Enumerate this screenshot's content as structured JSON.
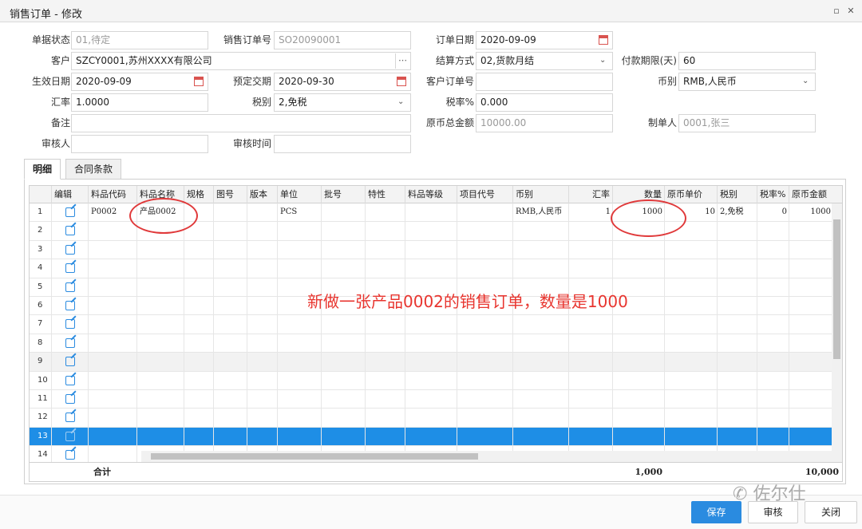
{
  "window": {
    "title": "销售订单 - 修改"
  },
  "form": {
    "status_label": "单据状态",
    "status_value": "01,待定",
    "order_no_label": "销售订单号",
    "order_no_value": "SO20090001",
    "order_date_label": "订单日期",
    "order_date_value": "2020-09-09",
    "customer_label": "客户",
    "customer_value": "SZCY0001,苏州XXXX有限公司",
    "settle_label": "结算方式",
    "settle_value": "02,货款月结",
    "pay_term_label": "付款期限(天)",
    "pay_term_value": "60",
    "effective_date_label": "生效日期",
    "effective_date_value": "2020-09-09",
    "delivery_date_label": "预定交期",
    "delivery_date_value": "2020-09-30",
    "cust_order_label": "客户订单号",
    "cust_order_value": "",
    "currency_label": "币别",
    "currency_value": "RMB,人民币",
    "rate_label": "汇率",
    "rate_value": "1.0000",
    "tax_label": "税别",
    "tax_value": "2,免税",
    "tax_rate_label": "税率%",
    "tax_rate_value": "0.000",
    "remark_label": "备注",
    "remark_value": "",
    "total_label": "原币总金额",
    "total_value": "10000.00",
    "maker_label": "制单人",
    "maker_value": "0001,张三",
    "auditor_label": "审核人",
    "auditor_value": "",
    "audit_time_label": "审核时间",
    "audit_time_value": ""
  },
  "tabs": [
    {
      "label": "明细"
    },
    {
      "label": "合同条款"
    }
  ],
  "grid": {
    "headers": [
      "编辑",
      "料品代码",
      "料品名称",
      "规格",
      "图号",
      "版本",
      "单位",
      "批号",
      "特性",
      "料品等级",
      "项目代号",
      "币别",
      "汇率",
      "数量",
      "原币单价",
      "税别",
      "税率%",
      "原币金额"
    ],
    "row_numbers": [
      "1",
      "2",
      "3",
      "4",
      "5",
      "6",
      "7",
      "8",
      "9",
      "10",
      "11",
      "12",
      "13",
      "14"
    ],
    "row1": {
      "code": "P0002",
      "name": "产品0002",
      "unit": "PCS",
      "currency": "RMB,人民币",
      "rate": "1",
      "qty": "1000",
      "price": "10",
      "tax": "2,免税",
      "tax_rate": "0",
      "amount": "1000"
    },
    "totals": {
      "label": "合计",
      "qty": "1,000",
      "amount": "10,000"
    }
  },
  "annotation": "新做一张产品0002的销售订单，数量是1000",
  "buttons": {
    "save": "保存",
    "audit": "审核",
    "close": "关闭"
  },
  "watermark": "佐尔仕",
  "colors": {
    "accent": "#2a8be0",
    "selected_row": "#1e8ee6",
    "annotation": "#e8352f"
  }
}
